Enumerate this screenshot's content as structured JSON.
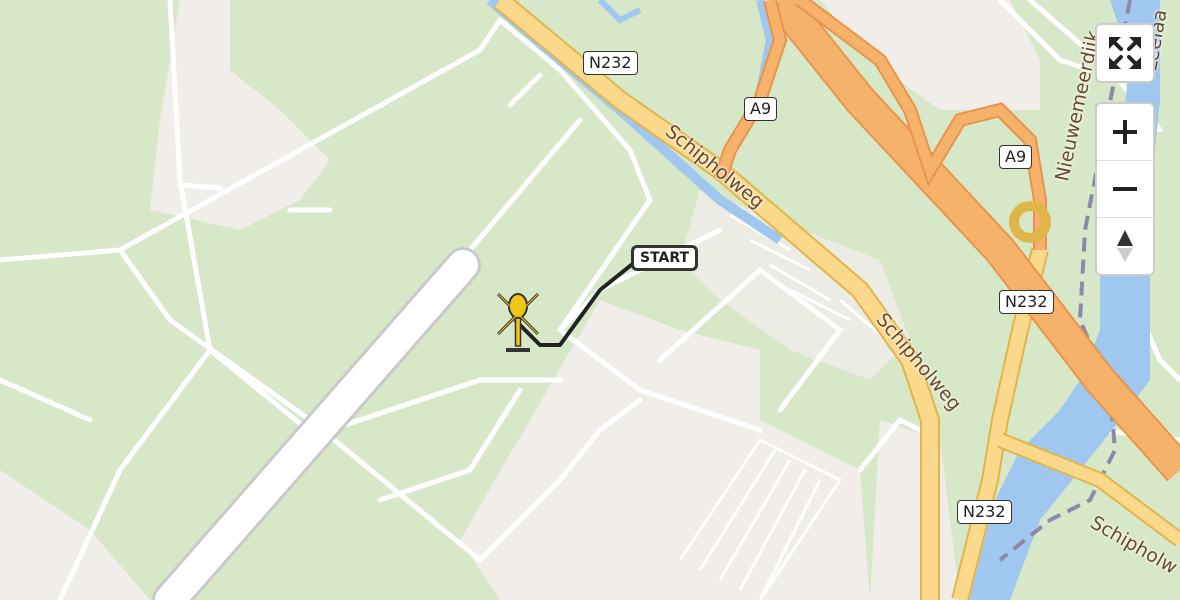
{
  "map": {
    "route_shields": [
      {
        "id": "n232-top",
        "label": "N232"
      },
      {
        "id": "a9-top",
        "label": "A9"
      },
      {
        "id": "a9-right",
        "label": "A9"
      },
      {
        "id": "n232-mid",
        "label": "N232"
      },
      {
        "id": "n232-bottom",
        "label": "N232"
      }
    ],
    "street_labels": [
      {
        "id": "schipholweg-1",
        "label": "Schipholweg"
      },
      {
        "id": "schipholweg-2",
        "label": "Schipholweg"
      },
      {
        "id": "schipholweg-3",
        "label": "Schipholw"
      },
      {
        "id": "nieuwemeerdijk",
        "label": "Nieuwemeerdijk"
      },
      {
        "id": "edge-label",
        "label": "Leelaa"
      }
    ],
    "start_marker": {
      "label": "START"
    },
    "colors": {
      "land": "#d6e8c8",
      "apron": "#f1eee9",
      "highway": "#f6b26b",
      "primary": "#fbd98c",
      "water": "#9fc7ef",
      "route": "#222222",
      "helicopter": "#f2c618"
    }
  },
  "controls": {
    "fullscreen": {
      "icon": "expand-arrows-icon"
    },
    "zoom_in": {
      "icon": "plus-icon"
    },
    "zoom_out": {
      "icon": "minus-icon"
    },
    "reset_north": {
      "icon": "compass-icon"
    }
  }
}
